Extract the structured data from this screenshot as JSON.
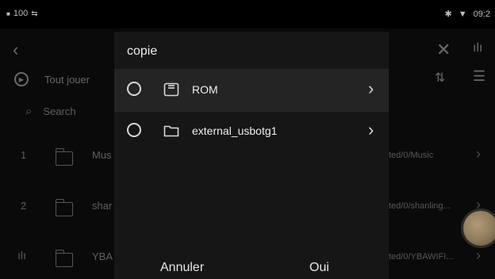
{
  "status": {
    "left_text": "100",
    "time": "09:2"
  },
  "background": {
    "play_all_label": "Tout jouer",
    "search_placeholder": "Search",
    "rows": [
      {
        "num": "1",
        "name": "Mus",
        "path": "ted/0/Music"
      },
      {
        "num": "2",
        "name": "shar",
        "path": "ted/0/shanling..."
      },
      {
        "num": "",
        "name": "YBA",
        "path": "ted/0/YBAWIFI..."
      }
    ]
  },
  "dialog": {
    "title": "copie",
    "options": [
      {
        "label": "ROM",
        "icon": "sd-card-icon",
        "selected": true
      },
      {
        "label": "external_usbotg1",
        "icon": "folder-icon",
        "selected": false
      }
    ],
    "cancel_label": "Annuler",
    "ok_label": "Oui"
  }
}
